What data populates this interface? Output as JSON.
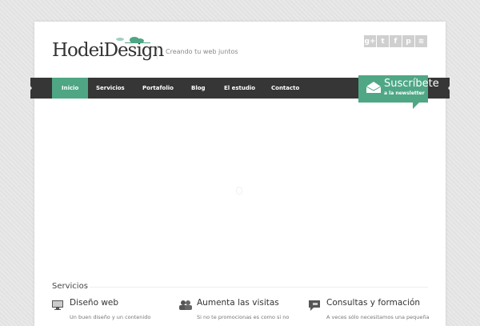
{
  "header": {
    "logo": "HodeiDesign",
    "tagline": "Creando tu web juntos"
  },
  "social": [
    {
      "icon": "google-plus-icon",
      "glyph": "g+"
    },
    {
      "icon": "twitter-icon",
      "glyph": "t"
    },
    {
      "icon": "facebook-icon",
      "glyph": "f"
    },
    {
      "icon": "pinterest-icon",
      "glyph": "p"
    },
    {
      "icon": "rss-icon",
      "glyph": "≋"
    }
  ],
  "nav": [
    "Inicio",
    "Servicios",
    "Portafolio",
    "Blog",
    "El estudio",
    "Contacto"
  ],
  "subscribe": {
    "title": "Suscríbete",
    "subtitle": "a la newsletter"
  },
  "services": {
    "heading": "Servicios",
    "items": [
      {
        "title": "Diseño web",
        "text": "Un buen diseño y un contenido"
      },
      {
        "title": "Aumenta las visitas",
        "text": "Si no te promocionas es como si no"
      },
      {
        "title": "Consultas y formación",
        "text": "A veces sólo necesitamos una pequeña"
      }
    ]
  },
  "colors": {
    "accent": "#4ea684",
    "nav": "#363636"
  }
}
